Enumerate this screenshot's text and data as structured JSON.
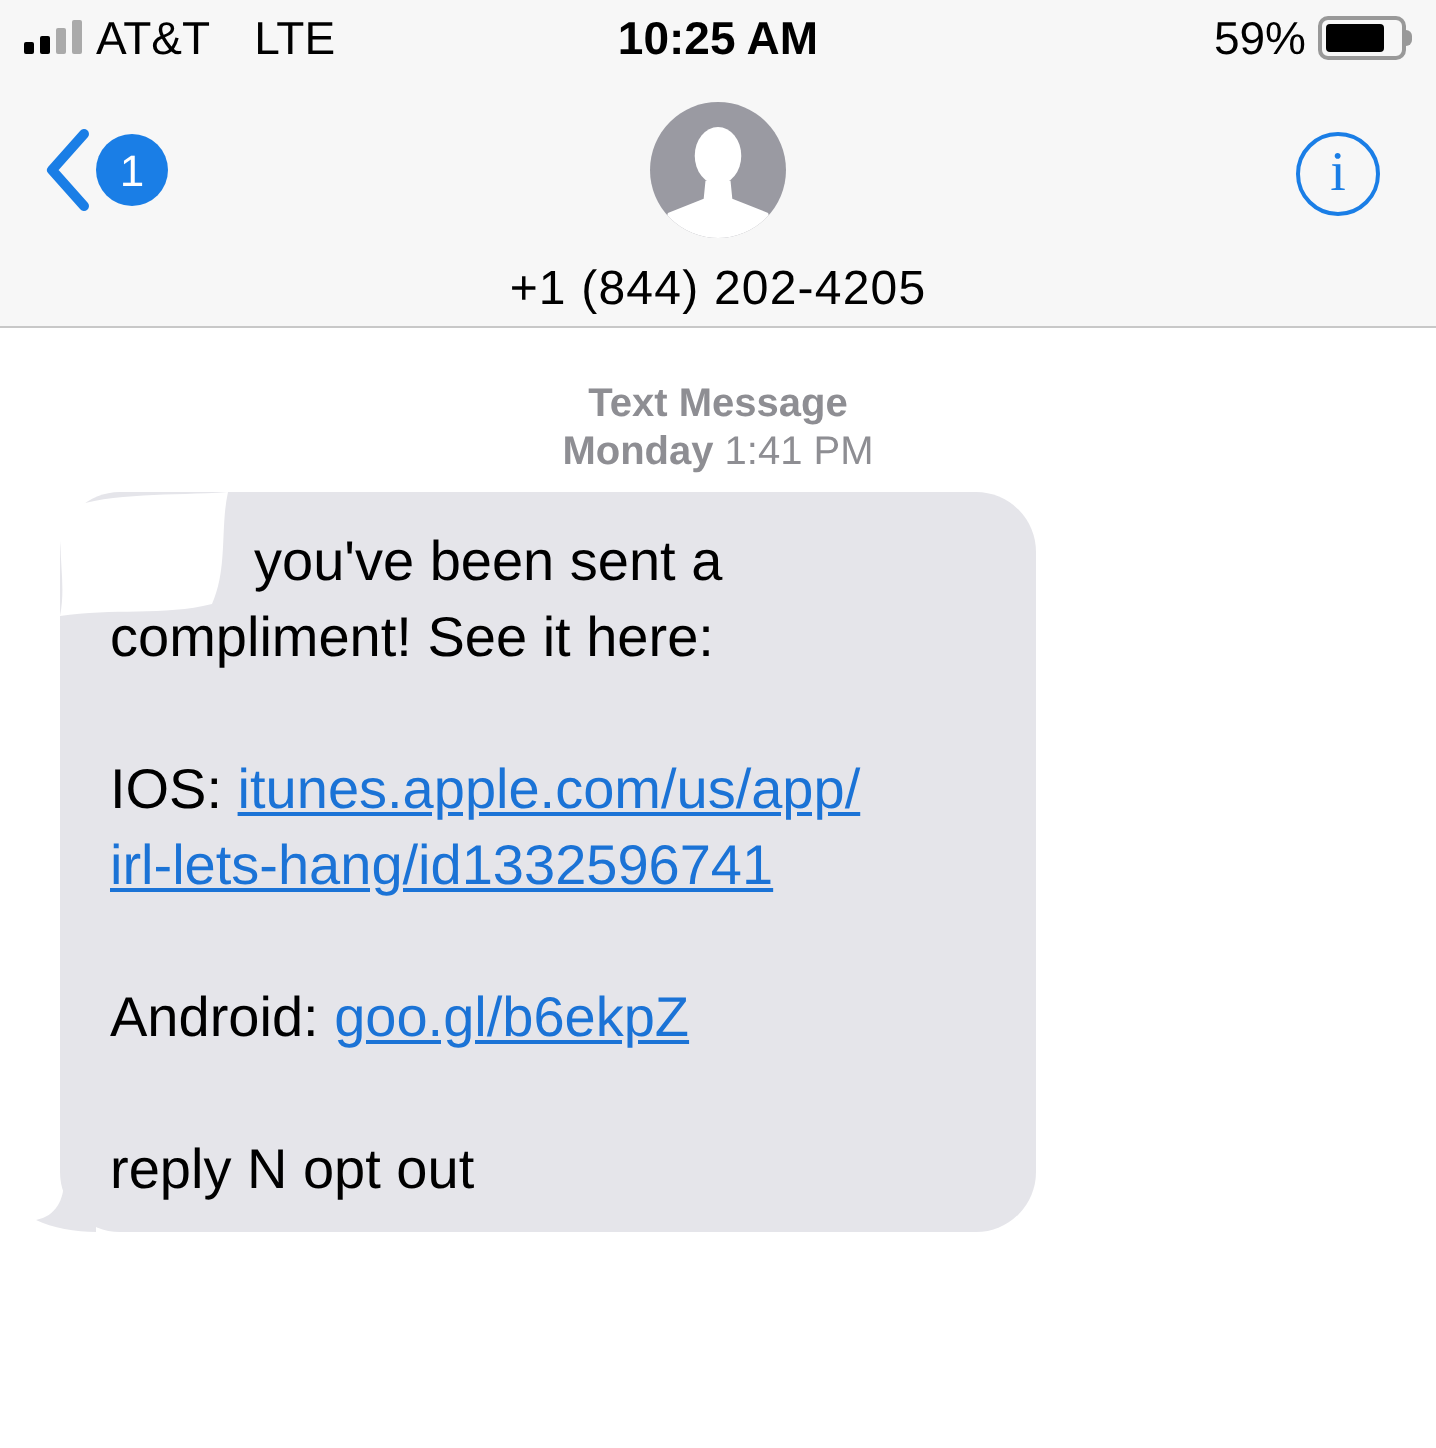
{
  "status_bar": {
    "carrier": "AT&T",
    "network": "LTE",
    "time": "10:25 AM",
    "battery_percent": "59%"
  },
  "nav": {
    "back_badge": "1",
    "contact": "+1 (844) 202-4205",
    "info": "i"
  },
  "timestamp": {
    "label": "Text Message",
    "time": "**Monday** 1:41 PM"
  },
  "message": {
    "paragraphs": [
      {
        "lines": [
          [
            {
              "kind": "text",
              "text": "you've been sent a"
            }
          ],
          [
            {
              "kind": "text",
              "text": "compliment! See it here:"
            }
          ]
        ]
      },
      {
        "lines": [
          [
            {
              "kind": "text",
              "text": "IOS: "
            },
            {
              "kind": "link",
              "text": "itunes.apple.com/us/app/"
            }
          ],
          [
            {
              "kind": "link",
              "text": "irl-lets-hang/id1332596741"
            }
          ]
        ]
      },
      {
        "lines": [
          [
            {
              "kind": "text",
              "text": "Android: "
            },
            {
              "kind": "link",
              "text": "goo.gl/b6ekpZ"
            }
          ]
        ]
      },
      {
        "lines": [
          [
            {
              "kind": "text",
              "text": "reply N opt out"
            }
          ]
        ]
      }
    ]
  }
}
